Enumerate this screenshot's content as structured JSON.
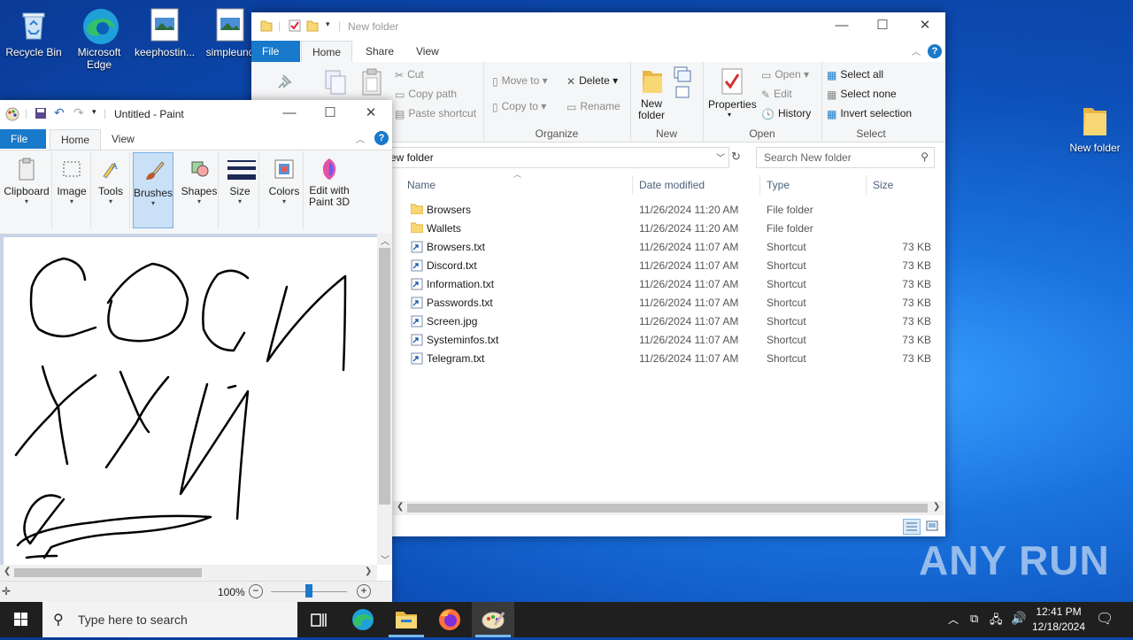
{
  "desktop": {
    "icons": [
      {
        "label": "Recycle Bin"
      },
      {
        "label": "Microsoft Edge"
      },
      {
        "label": "keephostin..."
      },
      {
        "label": "simpleund"
      },
      {
        "label": "New folder"
      }
    ]
  },
  "explorer": {
    "title": "New folder",
    "tabs": [
      "File",
      "Home",
      "Share",
      "View"
    ],
    "clipboard": {
      "cut": "Cut",
      "copy_path": "Copy path",
      "paste_shortcut": "Paste shortcut"
    },
    "organize": {
      "move_to": "Move to",
      "copy_to": "Copy to",
      "delete": "Delete",
      "rename": "Rename",
      "label": "Organize"
    },
    "new": {
      "new_folder": "New\nfolder",
      "new_folder_l1": "New",
      "new_folder_l2": "folder",
      "label": "New"
    },
    "open": {
      "properties": "Properties",
      "open": "Open",
      "edit": "Edit",
      "history": "History",
      "label": "Open"
    },
    "select": {
      "select_all": "Select all",
      "select_none": "Select none",
      "invert": "Invert selection",
      "label": "Select"
    },
    "address": "ew folder",
    "search_placeholder": "Search New folder",
    "columns": {
      "name": "Name",
      "date": "Date modified",
      "type": "Type",
      "size": "Size"
    },
    "files": [
      {
        "name": "Browsers",
        "date": "11/26/2024 11:20 AM",
        "type": "File folder",
        "size": "",
        "kind": "folder"
      },
      {
        "name": "Wallets",
        "date": "11/26/2024 11:20 AM",
        "type": "File folder",
        "size": "",
        "kind": "folder"
      },
      {
        "name": "Browsers.txt",
        "date": "11/26/2024 11:07 AM",
        "type": "Shortcut",
        "size": "73 KB",
        "kind": "shortcut"
      },
      {
        "name": "Discord.txt",
        "date": "11/26/2024 11:07 AM",
        "type": "Shortcut",
        "size": "73 KB",
        "kind": "shortcut"
      },
      {
        "name": "Information.txt",
        "date": "11/26/2024 11:07 AM",
        "type": "Shortcut",
        "size": "73 KB",
        "kind": "shortcut"
      },
      {
        "name": "Passwords.txt",
        "date": "11/26/2024 11:07 AM",
        "type": "Shortcut",
        "size": "73 KB",
        "kind": "shortcut"
      },
      {
        "name": "Screen.jpg",
        "date": "11/26/2024 11:07 AM",
        "type": "Shortcut",
        "size": "73 KB",
        "kind": "shortcut"
      },
      {
        "name": "Systeminfos.txt",
        "date": "11/26/2024 11:07 AM",
        "type": "Shortcut",
        "size": "73 KB",
        "kind": "shortcut"
      },
      {
        "name": "Telegram.txt",
        "date": "11/26/2024 11:07 AM",
        "type": "Shortcut",
        "size": "73 KB",
        "kind": "shortcut"
      }
    ]
  },
  "paint": {
    "title": "Untitled - Paint",
    "tabs": [
      "File",
      "Home",
      "View"
    ],
    "tools": [
      "Clipboard",
      "Image",
      "Tools",
      "Brushes",
      "Shapes",
      "Size",
      "Colors",
      "Edit with\nPaint 3D"
    ],
    "tool_edit3d_l1": "Edit with",
    "tool_edit3d_l2": "Paint 3D",
    "zoom": "100%"
  },
  "taskbar": {
    "search_placeholder": "Type here to search",
    "time": "12:41 PM",
    "date": "12/18/2024"
  },
  "watermark": "ANY RUN",
  "colors": {
    "accent": "#1979ca",
    "taskbar": "#1f1f1f",
    "folder": "#f8d775"
  }
}
